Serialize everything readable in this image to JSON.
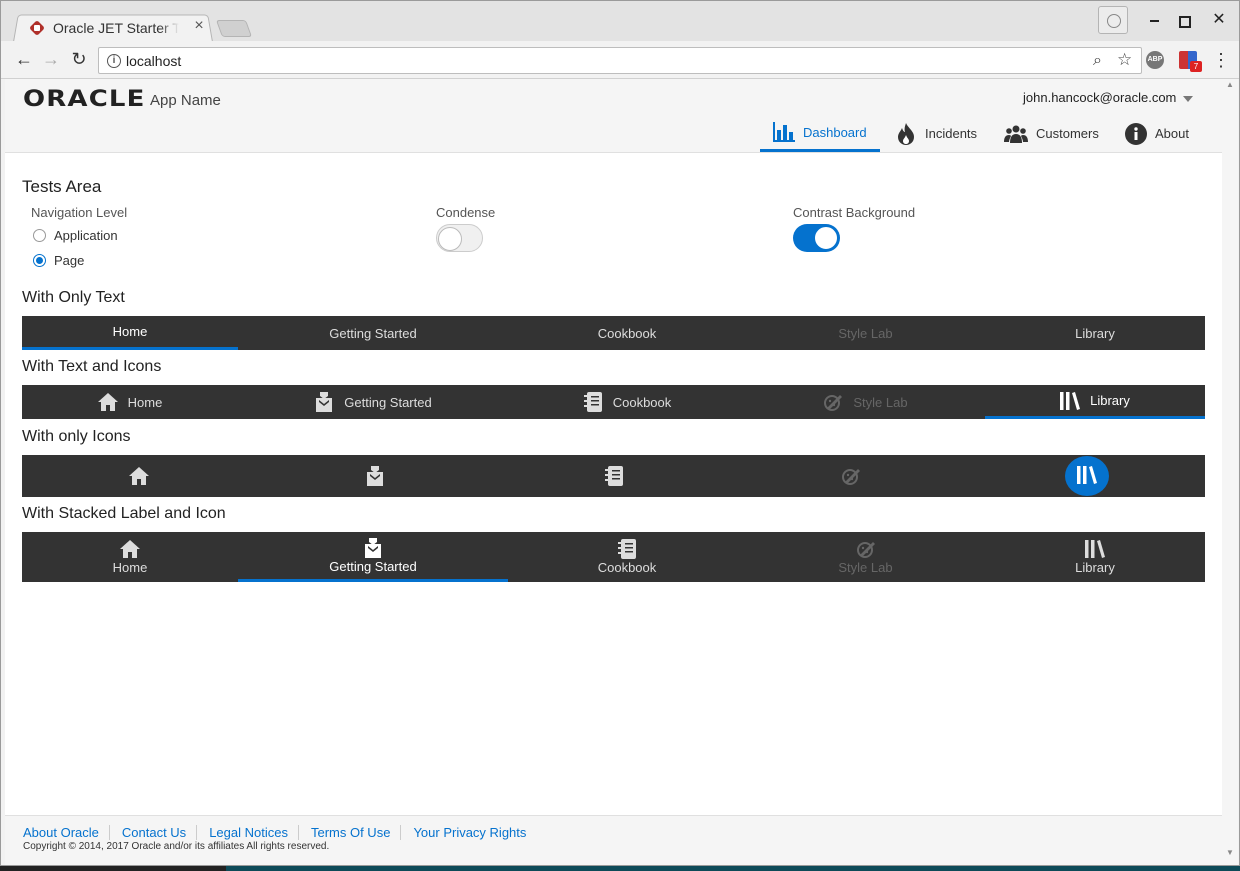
{
  "browser": {
    "tab_title": "Oracle JET Starter Template",
    "url": "localhost",
    "ext_badge": "7",
    "ext_abp": "ABP"
  },
  "header": {
    "logo": "ORACLE",
    "app_name": "App Name",
    "user": "john.hancock@oracle.com",
    "nav": [
      {
        "label": "Dashboard",
        "icon": "bar-chart-icon",
        "active": true
      },
      {
        "label": "Incidents",
        "icon": "fire-icon",
        "active": false
      },
      {
        "label": "Customers",
        "icon": "people-icon",
        "active": false
      },
      {
        "label": "About",
        "icon": "info-icon",
        "active": false
      }
    ]
  },
  "tests": {
    "title": "Tests Area",
    "navigation_level_label": "Navigation Level",
    "options": [
      "Application",
      "Page"
    ],
    "selected_option": "Page",
    "condense_label": "Condense",
    "condense_on": false,
    "contrast_label": "Contrast Background",
    "contrast_on": true
  },
  "sections": {
    "text_only": "With Only Text",
    "text_icons": "With Text and Icons",
    "icons_only": "With only Icons",
    "stacked": "With Stacked Label and Icon"
  },
  "nav_items": [
    "Home",
    "Getting Started",
    "Cookbook",
    "Style Lab",
    "Library"
  ],
  "footer": {
    "links": [
      "About Oracle",
      "Contact Us",
      "Legal Notices",
      "Terms Of Use",
      "Your Privacy Rights"
    ],
    "copyright": "Copyright © 2014, 2017 Oracle and/or its affiliates All rights reserved."
  },
  "colors": {
    "accent": "#0572ce",
    "navbar_bg": "#333333"
  }
}
